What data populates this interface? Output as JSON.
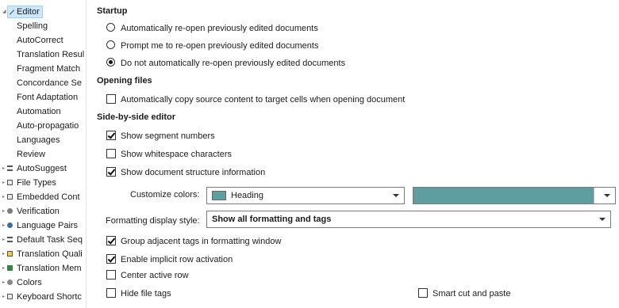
{
  "sidebar": {
    "items": [
      {
        "label": "Editor",
        "icon": "pencil-icon",
        "selected": true,
        "expander": "open"
      },
      {
        "label": "Spelling"
      },
      {
        "label": "AutoCorrect"
      },
      {
        "label": "Translation Resul"
      },
      {
        "label": "Fragment Match"
      },
      {
        "label": "Concordance Se"
      },
      {
        "label": "Font Adaptation"
      },
      {
        "label": "Automation"
      },
      {
        "label": "Auto-propagatio"
      },
      {
        "label": "Languages"
      },
      {
        "label": "Review"
      },
      {
        "label": "AutoSuggest",
        "icon": "autosuggest-icon",
        "expander": "closed"
      },
      {
        "label": "File Types",
        "icon": "file-types-icon",
        "expander": "closed"
      },
      {
        "label": "Embedded Cont",
        "icon": "embedded-content-icon",
        "expander": "closed"
      },
      {
        "label": "Verification",
        "icon": "verification-icon",
        "expander": "closed"
      },
      {
        "label": "Language Pairs",
        "icon": "language-pairs-icon",
        "expander": "closed"
      },
      {
        "label": "Default Task Seq",
        "icon": "task-sequence-icon",
        "expander": "closed"
      },
      {
        "label": "Translation Quali",
        "icon": "translation-quality-icon",
        "expander": "closed"
      },
      {
        "label": "Translation Mem",
        "icon": "translation-memory-icon",
        "expander": "closed"
      },
      {
        "label": "Colors",
        "icon": "colors-icon",
        "expander": "closed"
      },
      {
        "label": "Keyboard Shortc",
        "icon": "keyboard-icon",
        "expander": "closed"
      }
    ]
  },
  "startup": {
    "title": "Startup",
    "options": [
      {
        "label": "Automatically re-open previously edited documents",
        "selected": false
      },
      {
        "label": "Prompt me to re-open previously edited documents",
        "selected": false
      },
      {
        "label": "Do not automatically re-open previously edited documents",
        "selected": true
      }
    ]
  },
  "opening_files": {
    "title": "Opening files",
    "copy_source": {
      "label": "Automatically copy source content to target cells when opening document",
      "checked": false
    }
  },
  "side_by_side": {
    "title": "Side-by-side editor",
    "show_segment_numbers": {
      "label": "Show segment numbers",
      "checked": true
    },
    "show_whitespace": {
      "label": "Show whitespace characters",
      "checked": false
    },
    "show_structure": {
      "label": "Show document structure information",
      "checked": true
    },
    "customize_colors": {
      "label": "Customize colors:",
      "selected": "Heading",
      "swatch_color": "#5f9ea0",
      "color_value": "#5f9ea0"
    },
    "formatting_style": {
      "label": "Formatting display style:",
      "selected": "Show all formatting and tags"
    },
    "group_tags": {
      "label": "Group adjacent tags in formatting window",
      "checked": true
    },
    "implicit_row": {
      "label": "Enable implicit row activation",
      "checked": true
    },
    "center_row": {
      "label": "Center active row",
      "checked": false
    },
    "hide_file_tags": {
      "label": "Hide file tags",
      "checked": false
    },
    "smart_cut": {
      "label": "Smart cut and paste",
      "checked": false
    }
  }
}
